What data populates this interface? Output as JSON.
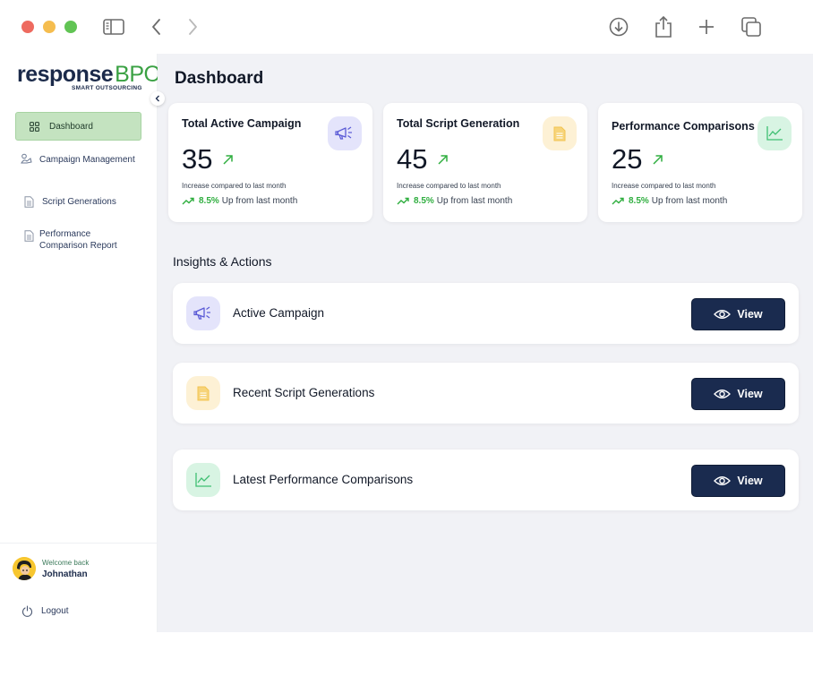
{
  "window": {
    "colors": {
      "close": "#ee6a5f",
      "minimize": "#f5bd4f",
      "zoom": "#61c454"
    },
    "toolbar_icons": [
      "sidebar-toggle-icon",
      "back-icon",
      "forward-icon",
      "download-icon",
      "share-icon",
      "new-tab-icon",
      "tabs-overview-icon"
    ]
  },
  "brand": {
    "name": "response",
    "suffix": "BPO",
    "tagline": "SMART OUTSOURCING",
    "color_primary": "#1b2a4a",
    "color_accent": "#3aa143"
  },
  "sidebar": {
    "items": [
      {
        "label": "Dashboard",
        "icon": "grid-icon",
        "active": true
      },
      {
        "label": "Campaign Management",
        "icon": "campaign-icon",
        "active": false
      },
      {
        "label": "Script Generations",
        "icon": "document-icon",
        "active": false
      },
      {
        "label": "Performance\nComparison Report",
        "label_line1": "Performance",
        "label_line2": "Comparison Report",
        "icon": "document-icon",
        "active": false
      }
    ],
    "user": {
      "greeting": "Welcome back",
      "name": "Johnathan"
    },
    "logout_label": "Logout"
  },
  "page": {
    "title": "Dashboard"
  },
  "stats": [
    {
      "title": "Total Active Campaign",
      "value": "35",
      "subtitle": "Increase compared to last month",
      "trend_pct": "8.5%",
      "trend_text": "Up from last month",
      "icon": "megaphone-icon",
      "icon_bg": "#e4e4fb",
      "icon_color": "#5b5bd6"
    },
    {
      "title": "Total Script Generation",
      "value": "45",
      "subtitle": "Increase compared to last month",
      "trend_pct": "8.5%",
      "trend_text": "Up from last month",
      "icon": "document-icon",
      "icon_bg": "#fdf1d5",
      "icon_color": "#f2c451"
    },
    {
      "title": "Performance Comparisons",
      "value": "25",
      "subtitle": "Increase compared to last month",
      "trend_pct": "8.5%",
      "trend_text": "Up from last month",
      "icon": "line-chart-icon",
      "icon_bg": "#d8f4e3",
      "icon_color": "#3fbf72"
    }
  ],
  "insights": {
    "title": "Insights & Actions",
    "rows": [
      {
        "label": "Active Campaign",
        "button": "View",
        "icon": "megaphone-icon",
        "icon_bg": "#e4e4fb"
      },
      {
        "label": "Recent Script Generations",
        "button": "View",
        "icon": "document-icon",
        "icon_bg": "#fdf1d5"
      },
      {
        "label": "Latest Performance Comparisons",
        "button": "View",
        "icon": "line-chart-icon",
        "icon_bg": "#d8f4e3"
      }
    ]
  }
}
